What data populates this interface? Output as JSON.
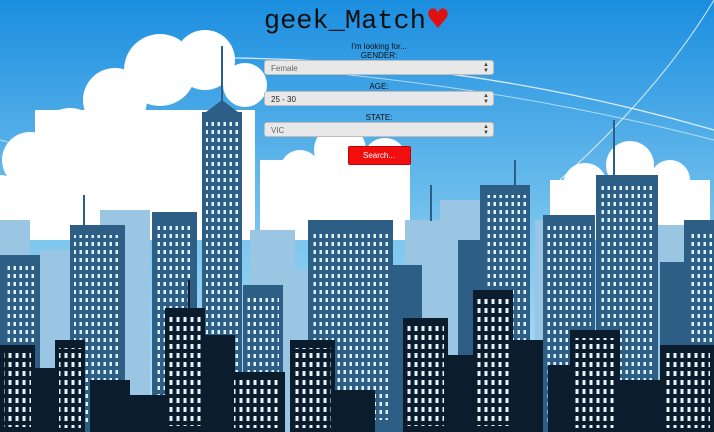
{
  "header": {
    "title": "geek_Match",
    "heart": "♥"
  },
  "form": {
    "intro": "I'm looking for...",
    "gender": {
      "label": "GENDER:",
      "value": "Female"
    },
    "age": {
      "label": "AGE:",
      "value": "25 - 30"
    },
    "state": {
      "label": "STATE:",
      "value": "VIC"
    },
    "search_label": "Search..."
  },
  "colors": {
    "accent": "#f20e0e",
    "sky_top": "#1b8ee0",
    "sky_bottom": "#bfe4f6"
  }
}
